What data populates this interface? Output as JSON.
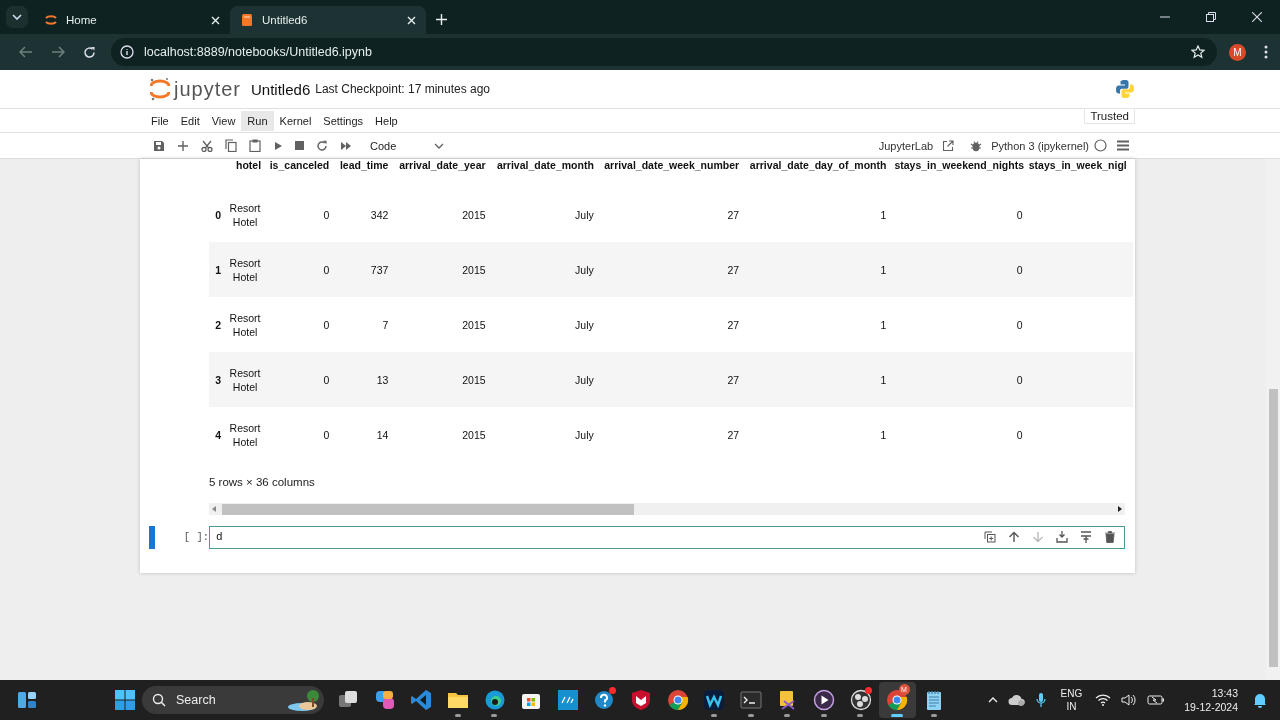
{
  "browser": {
    "tabs": [
      {
        "title": "Home",
        "kind": "jupyter",
        "selected": false
      },
      {
        "title": "Untitled6",
        "kind": "notebook",
        "selected": true
      }
    ],
    "url": "localhost:8889/notebooks/Untitled6.ipynb",
    "profile": "M"
  },
  "header": {
    "logo": "jupyter",
    "title": "Untitled6",
    "checkpoint": "Last Checkpoint: 17 minutes ago",
    "trusted": "Trusted"
  },
  "menu": [
    {
      "label": "File",
      "highlighted": false
    },
    {
      "label": "Edit",
      "highlighted": false
    },
    {
      "label": "View",
      "highlighted": false
    },
    {
      "label": "Run",
      "highlighted": true
    },
    {
      "label": "Kernel",
      "highlighted": false
    },
    {
      "label": "Settings",
      "highlighted": false
    },
    {
      "label": "Help",
      "highlighted": false
    }
  ],
  "toolbar": {
    "buttons": [
      {
        "kind": "save"
      },
      {
        "kind": "add"
      },
      {
        "kind": "cut"
      },
      {
        "kind": "copy"
      },
      {
        "kind": "paste"
      },
      {
        "kind": "run"
      },
      {
        "kind": "stop"
      },
      {
        "kind": "restart"
      },
      {
        "kind": "run-all"
      }
    ],
    "cell_type": "Code",
    "lab_link": "JupyterLab",
    "kernel": "Python 3 (ipykernel)",
    "kernel_busy": false
  },
  "output": {
    "columns": [
      "",
      "hotel",
      "is_canceled",
      "lead_time",
      "arrival_date_year",
      "arrival_date_month",
      "arrival_date_week_number",
      "arrival_date_day_of_month",
      "stays_in_weekend_nights",
      "stays_in_week_nigl"
    ],
    "rows": [
      [
        "0",
        "Resort Hotel",
        "0",
        "342",
        "2015",
        "July",
        "27",
        "1",
        "0"
      ],
      [
        "1",
        "Resort Hotel",
        "0",
        "737",
        "2015",
        "July",
        "27",
        "1",
        "0"
      ],
      [
        "2",
        "Resort Hotel",
        "0",
        "7",
        "2015",
        "July",
        "27",
        "1",
        "0"
      ],
      [
        "3",
        "Resort Hotel",
        "0",
        "13",
        "2015",
        "July",
        "27",
        "1",
        "0"
      ],
      [
        "4",
        "Resort Hotel",
        "0",
        "14",
        "2015",
        "July",
        "27",
        "1",
        "0"
      ]
    ],
    "shape": "5 rows × 36 columns"
  },
  "input_cell": {
    "prompt": "[ ]:",
    "code": "d",
    "selected": true,
    "actions": [
      {
        "kind": "duplicate",
        "disabled": false
      },
      {
        "kind": "move-up",
        "disabled": false
      },
      {
        "kind": "move-down",
        "disabled": true
      },
      {
        "kind": "insert-above",
        "disabled": false
      },
      {
        "kind": "insert-below",
        "disabled": false
      },
      {
        "kind": "delete",
        "disabled": false
      }
    ]
  },
  "taskbar": {
    "search": "Search",
    "apps": [
      {
        "kind": "task-view",
        "running": false,
        "active": false,
        "notification": false
      },
      {
        "kind": "copilot",
        "running": false,
        "active": false,
        "notification": false
      },
      {
        "kind": "vscode",
        "running": false,
        "active": false,
        "notification": false
      },
      {
        "kind": "folder",
        "running": true,
        "active": false,
        "notification": false
      },
      {
        "kind": "edge",
        "running": true,
        "active": false,
        "notification": false
      },
      {
        "kind": "store",
        "running": false,
        "active": false,
        "notification": false
      },
      {
        "kind": "myhp",
        "running": false,
        "active": false,
        "notification": false
      },
      {
        "kind": "help",
        "running": false,
        "active": false,
        "notification": true
      },
      {
        "kind": "shield",
        "running": false,
        "active": false,
        "notification": false
      },
      {
        "kind": "chrome",
        "running": false,
        "active": false,
        "notification": false
      },
      {
        "kind": "webex",
        "running": true,
        "active": false,
        "notification": false
      },
      {
        "kind": "terminal",
        "running": true,
        "active": false,
        "notification": false
      },
      {
        "kind": "snip",
        "running": true,
        "active": false,
        "notification": false
      },
      {
        "kind": "player",
        "running": true,
        "active": false,
        "notification": false
      },
      {
        "kind": "obs",
        "running": true,
        "active": false,
        "notification": true
      },
      {
        "kind": "chrome",
        "running": true,
        "active": true,
        "badge": "M",
        "notification": false
      },
      {
        "kind": "notepad",
        "running": true,
        "active": false,
        "notification": false
      }
    ],
    "language": "ENG",
    "region": "IN",
    "time": "13:43",
    "date": "19-12-2024"
  }
}
